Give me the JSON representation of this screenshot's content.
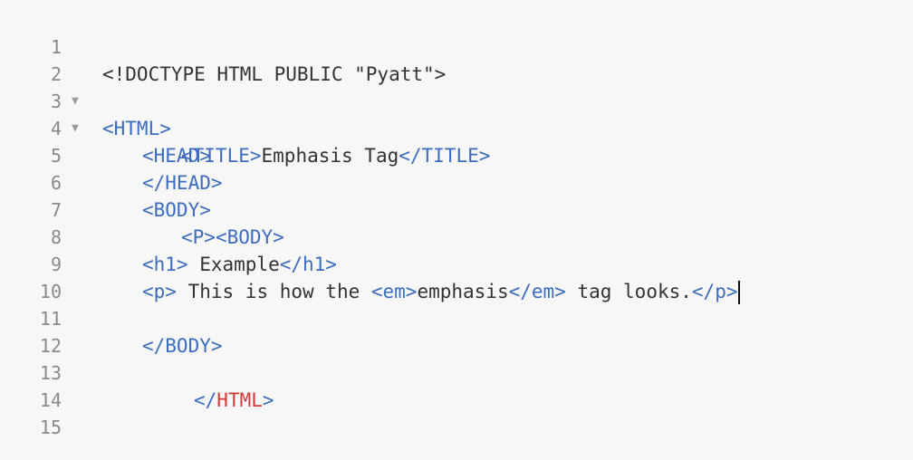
{
  "gutter": {
    "line_numbers": [
      "1",
      "2",
      "3",
      "4",
      "5",
      "6",
      "7",
      "8",
      "9",
      "10",
      "11",
      "12",
      "13",
      "14",
      "15"
    ],
    "fold_marker": "▼"
  },
  "code": {
    "l1": "<!DOCTYPE HTML PUBLIC \"Pyatt\">",
    "l2_tag": "<HTML>",
    "l3_tag": "<HEAD>",
    "l4_open": "<TITLE>",
    "l4_text": "Emphasis Tag",
    "l4_close": "</TITLE>",
    "l5_tag": "</HEAD>",
    "l6_tag": "<BODY>",
    "l7_p": "<P>",
    "l7_body": "<BODY>",
    "l8_open": "<h1>",
    "l8_text": " Example",
    "l8_close": "</h1>",
    "l9_p_open": "<p>",
    "l9_text1": " This is how the ",
    "l9_em_open": "<em>",
    "l9_em_text": "emphasis",
    "l9_em_close": "</em>",
    "l9_text2": " tag looks.",
    "l9_p_close": "</p>",
    "l11_tag": "</BODY>",
    "l13_open": "</",
    "l13_name": "HTML",
    "l13_close": ">"
  },
  "colors": {
    "tag": "#3c6dbf",
    "text": "#333333",
    "error_tag": "#d23a3a",
    "gutter": "#8a8a8a",
    "background": "#f7f7f7"
  }
}
